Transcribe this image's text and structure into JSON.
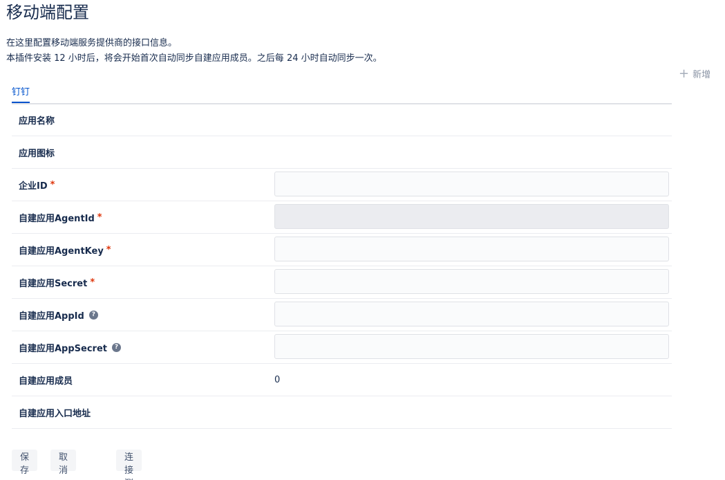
{
  "header": {
    "title": "移动端配置",
    "description_1": "在这里配置移动端服务提供商的接口信息。",
    "description_2": "本插件安装 12 小时后，将会开始首次自动同步自建应用成员。之后每 24 小时自动同步一次。"
  },
  "actions": {
    "add_icon": "plus-icon",
    "add_label": "新增"
  },
  "tabs": [
    {
      "label": "钉钉",
      "active": true
    }
  ],
  "form": {
    "app_name": {
      "label": "应用名称"
    },
    "app_icon": {
      "label": "应用图标"
    },
    "corp_id": {
      "label": "企业ID",
      "required_mark": "*",
      "value": ""
    },
    "agent_id": {
      "label": "自建应用AgentId",
      "required_mark": "*",
      "value": "",
      "disabled": true
    },
    "agent_key": {
      "label": "自建应用AgentKey",
      "required_mark": "*",
      "value": ""
    },
    "secret": {
      "label": "自建应用Secret",
      "required_mark": "*",
      "value": ""
    },
    "app_id": {
      "label": "自建应用AppId",
      "help_icon": "question-circle-icon",
      "help_glyph": "?",
      "value": ""
    },
    "app_secret": {
      "label": "自建应用AppSecret",
      "help_icon": "question-circle-icon",
      "help_glyph": "?",
      "value": ""
    },
    "members": {
      "label": "自建应用成员",
      "value": "0"
    },
    "entry_url": {
      "label": "自建应用入口地址"
    }
  },
  "footer": {
    "save_label": "保存",
    "cancel_label": "取消",
    "test_label": "连接测试"
  },
  "colors": {
    "accent": "#0052cc",
    "required": "#de350b",
    "text": "#172b4d",
    "muted": "#8993a4"
  }
}
